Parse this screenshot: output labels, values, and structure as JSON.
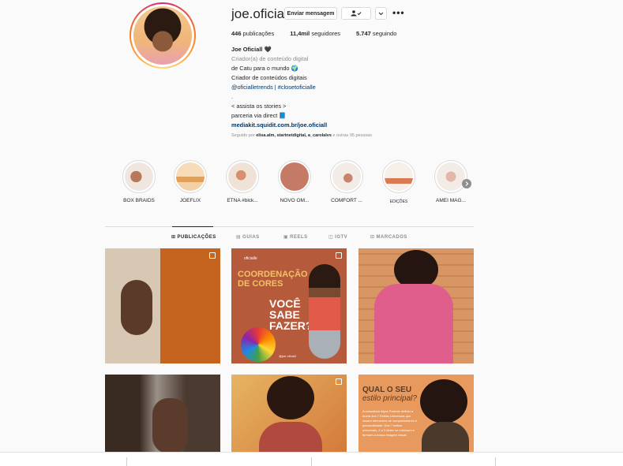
{
  "profile": {
    "username": "joe.oficiall",
    "message_label": "Enviar mensagem",
    "more": "•••",
    "stats": {
      "posts_count": "446",
      "posts_label": "publicações",
      "followers_count": "11,4mil",
      "followers_label": "seguidores",
      "following_count": "5.747",
      "following_label": "seguindo"
    },
    "bio": {
      "name": "Joe Oficiall 🖤",
      "category": "Criador(a) de conteúdo digital",
      "line1": "de Catu para o mundo 🌍",
      "line2": "Criador de conteúdos digitais",
      "line3": "@oficialletrends | #closetoficialle",
      "line4": ".",
      "line5": "< assista os stories >",
      "line6": "parceria via direct 📘",
      "link": "mediakit.squidit.com.br/joe.oficiall"
    },
    "followed_prefix": "Seguido por",
    "followed_names": "elisa.alm, startnetdigital, a_carolalvs",
    "followed_suffix": "e outras 95 pessoas"
  },
  "stories": [
    {
      "label": "BOX BRAIDS",
      "color": "#f0e6df"
    },
    {
      "label": "JOEFLIX",
      "color": "#f2d1a7"
    },
    {
      "label": "ETNA #blck...",
      "color": "#efe3d8"
    },
    {
      "label": "NOVO OM...",
      "color": "#c57a66"
    },
    {
      "label": "COMFORT ...",
      "color": "#f3ece6"
    },
    {
      "label": "EDIÇÕES",
      "color": "#f6efe8"
    },
    {
      "label": "AMEI MAG...",
      "color": "#f3ece6"
    }
  ],
  "tabs": {
    "posts": "PUBLICAÇÕES",
    "guides": "GUIAS",
    "reels": "REELS",
    "igtv": "IGTV",
    "tagged": "MARCADOS"
  },
  "posts": {
    "p2_logo": "oficialle",
    "p2_title": "COORDENAÇÃO DE CORES",
    "p2_q1": "VOCÊ",
    "p2_q2": "SABE",
    "p2_q3": "FAZER?",
    "p2_handle": "@joe.oficiall",
    "p6_title1": "QUAL O SEU",
    "p6_title2": "estilo principal?",
    "p6_body": "A consultora Alyce Parente definiu a teoria dos 7 Estilos Universais que casam elementos de comportamento e personalidade. Dos 7 estilos universais, 2 a 3 deles se misturam e formam a nossa imagem visual."
  }
}
